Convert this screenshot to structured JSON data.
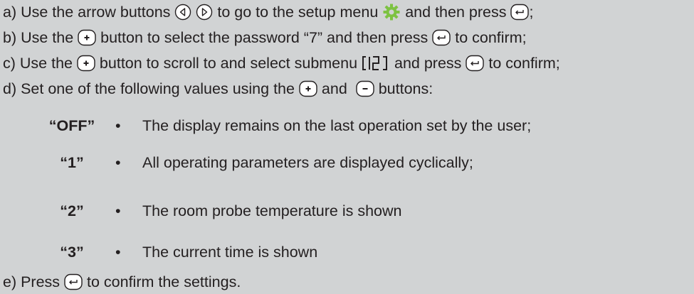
{
  "steps": [
    {
      "parts": [
        "a) Use the arrow buttons ",
        " ",
        " to go to the setup menu ",
        " and then press ",
        ";"
      ],
      "icons": [
        "left-arrow-button-icon",
        "right-arrow-button-icon",
        "gear-icon",
        "enter-button-icon"
      ]
    },
    {
      "parts": [
        "b) Use the ",
        " button to select the password “7” and then press ",
        " to confirm;"
      ],
      "icons": [
        "plus-button-icon",
        "enter-button-icon"
      ]
    },
    {
      "parts": [
        "c) Use the ",
        " button to scroll to and select submenu ",
        " and press ",
        " to confirm;"
      ],
      "icons": [
        "plus-button-icon",
        "submenu-c12-icon",
        "enter-button-icon"
      ]
    },
    {
      "parts": [
        "d) Set one of the following values using the ",
        " and  ",
        " buttons:"
      ],
      "icons": [
        "plus-button-icon",
        "minus-button-icon"
      ]
    },
    {
      "parts": [
        "e) Press ",
        " to confirm the settings."
      ],
      "icons": [
        "enter-button-icon"
      ]
    }
  ],
  "options": [
    {
      "key": "“OFF”",
      "bullet": "•",
      "text": "The display remains on the last operation set by the user;"
    },
    {
      "key": "“1”",
      "bullet": "•",
      "text": "All operating parameters are displayed cyclically;"
    },
    {
      "key": "“2”",
      "bullet": "•",
      "text": "The room probe temperature is shown"
    },
    {
      "key": "“3”",
      "bullet": "•",
      "text": "The current time is shown"
    }
  ],
  "colors": {
    "background": "#d1d3d4",
    "text": "#231f20",
    "gear": "#7dc242"
  }
}
